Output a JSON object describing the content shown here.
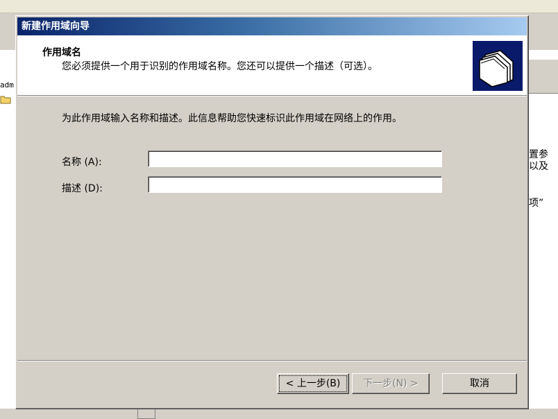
{
  "dialog": {
    "title": "新建作用域向导",
    "header_title": "作用域名",
    "header_subtitle": "您必须提供一个用于识别的作用域名称。您还可以提供一个描述（可选）。",
    "intro": "为此作用域输入名称和描述。此信息帮助您快速标识此作用域在网络上的作用。",
    "name_label": "名称 (A):",
    "name_value": "",
    "desc_label": "描述 (D):",
    "desc_value": "",
    "buttons": {
      "back": "< 上一步(B)",
      "next": "下一步(N) >",
      "cancel": "取消"
    }
  },
  "background": {
    "left_text": "adm",
    "right_lines": [
      "置参",
      "以及",
      "项”"
    ]
  },
  "colors": {
    "titlebar_start": "#0a246a",
    "titlebar_end": "#a6caf0",
    "face": "#d4d0c8",
    "header_icon_bg": "#0a1a6a"
  },
  "icons": {
    "header": "folder-stack-icon",
    "tree": "folder-icon"
  }
}
